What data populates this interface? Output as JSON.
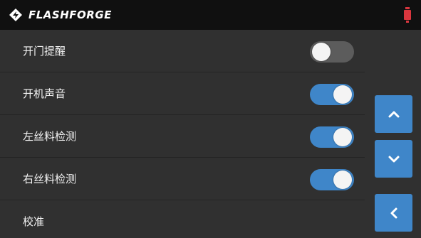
{
  "header": {
    "brand": "FLASHFORGE",
    "icons": {
      "logo": "flashforge-logo-icon",
      "status": "filament-status-icon"
    },
    "colors": {
      "background": "#101010",
      "status": "#d9363e"
    }
  },
  "settings": {
    "items": [
      {
        "label": "开门提醒",
        "state": "off"
      },
      {
        "label": "开机声音",
        "state": "on"
      },
      {
        "label": "左丝料检测",
        "state": "on"
      },
      {
        "label": "右丝料检测",
        "state": "on"
      },
      {
        "label": "校准"
      }
    ]
  },
  "nav": {
    "up_icon": "chevron-up-icon",
    "down_icon": "chevron-down-icon",
    "back_icon": "chevron-left-icon"
  },
  "colors": {
    "accent": "#3f86c9",
    "toggle_off": "#5c5c5c",
    "background": "#303030"
  }
}
